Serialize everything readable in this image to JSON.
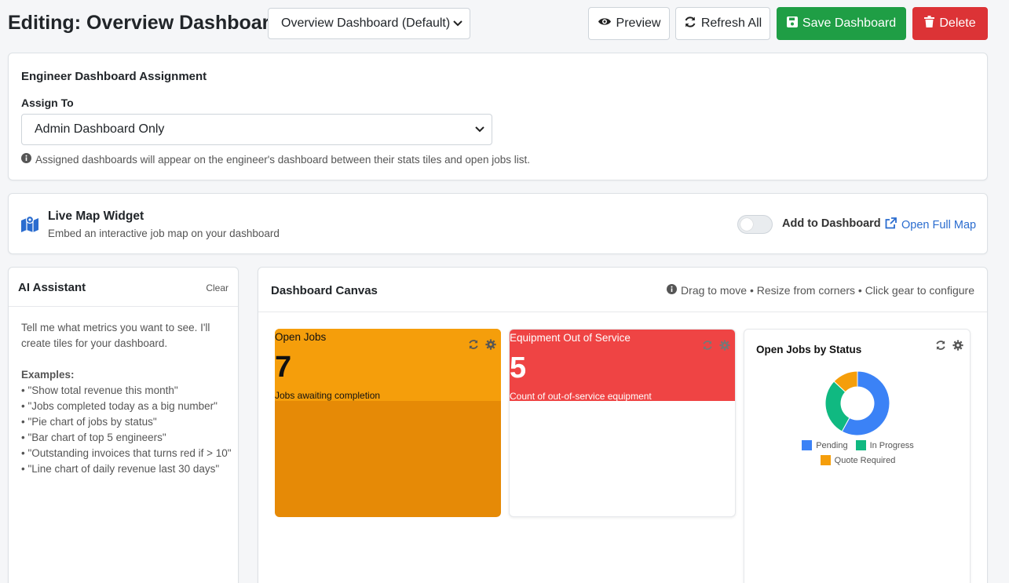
{
  "header": {
    "title": "Editing: Overview Dashboard",
    "dashboard_select": "Overview Dashboard (Default)",
    "preview_label": "Preview",
    "refresh_label": "Refresh All",
    "save_label": "Save Dashboard",
    "delete_label": "Delete"
  },
  "assignment": {
    "title": "Engineer Dashboard Assignment",
    "assign_label": "Assign To",
    "assign_value": "Admin Dashboard Only",
    "help_text": "Assigned dashboards will appear on the engineer's dashboard between their stats tiles and open jobs list."
  },
  "map_widget": {
    "title": "Live Map Widget",
    "subtitle": "Embed an interactive job map on your dashboard",
    "toggle_label": "Add to Dashboard",
    "toggle_on": false,
    "open_full_map": "Open Full Map"
  },
  "ai_assistant": {
    "title": "AI Assistant",
    "clear_label": "Clear",
    "intro": "Tell me what metrics you want to see. I'll create tiles for your dashboard.",
    "examples_title": "Examples:",
    "examples": [
      "• \"Show total revenue this month\"",
      "• \"Jobs completed today as a big number\"",
      "• \"Pie chart of jobs by status\"",
      "• \"Bar chart of top 5 engineers\"",
      "• \"Outstanding invoices that turns red if > 10\"",
      "• \"Line chart of daily revenue last 30 days\""
    ]
  },
  "canvas": {
    "title": "Dashboard Canvas",
    "hint": "Drag to move • Resize from corners • Click gear to configure",
    "tiles": [
      {
        "label": "Open Jobs",
        "value": "7",
        "caption": "Jobs awaiting completion",
        "color": "#f59e0b"
      },
      {
        "label": "Equipment Out of Service",
        "value": "5",
        "caption": "Count of out-of-service equipment",
        "color": "#ef4444"
      }
    ]
  },
  "chart_data": {
    "type": "pie",
    "title": "Open Jobs by Status",
    "categories": [
      "Pending",
      "In Progress",
      "Quote Required"
    ],
    "values": [
      58,
      29,
      13
    ],
    "colors": [
      "#3b82f6",
      "#10b981",
      "#f59e0b"
    ],
    "donut": true,
    "legend": "bottom"
  },
  "colors": {
    "save": "#1f9e45",
    "delete": "#dc3336",
    "link": "#2a6ccf"
  }
}
